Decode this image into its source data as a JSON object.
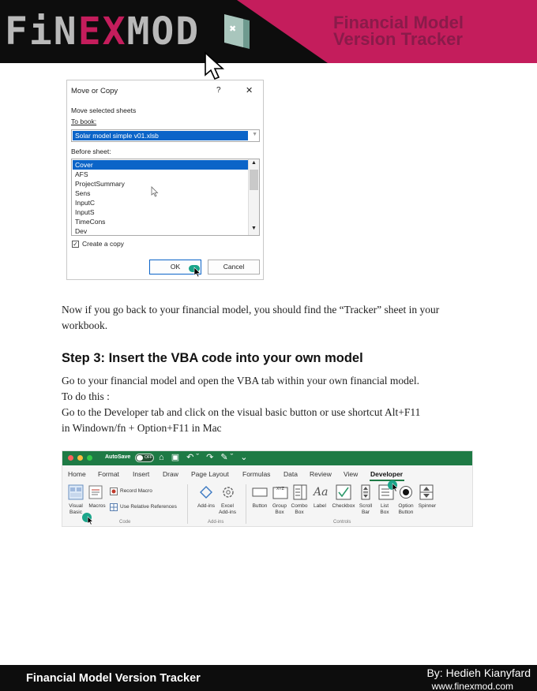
{
  "header": {
    "logo_part1": "FiN",
    "logo_part2": "EX",
    "logo_part3": "MOD",
    "title_line1": "Financial Model",
    "title_line2": "Version Tracker",
    "colors": {
      "banner_black": "#0d0d0d",
      "banner_pink": "#c41d5c",
      "logo_gray": "#b9b9b9"
    }
  },
  "dialog": {
    "title": "Move or Copy",
    "help": "?",
    "close": "✕",
    "move_selected_label": "Move selected sheets",
    "to_book_label": "To book:",
    "to_book_value": "Solar model simple v01.xlsb",
    "before_sheet_label": "Before sheet:",
    "sheets": [
      "Cover",
      "AFS",
      "ProjectSummary",
      "Sens",
      "InputC",
      "InputS",
      "TimeCons",
      "Dev"
    ],
    "selected_sheet": "Cover",
    "create_copy_label": "Create a copy",
    "create_copy_checked": true,
    "ok_label": "OK",
    "cancel_label": "Cancel"
  },
  "body": {
    "para1": "Now if you go back to your financial model, you should find the “Tracker” sheet in your workbook.",
    "step3_heading": "Step 3: Insert the VBA code into your own model",
    "para2_line1": "Go to your financial model and open the VBA tab within your own financial model.",
    "para2_line2": "To do this :",
    "para2_line3": "Go to the Developer tab and click on the visual basic button or use shortcut Alt+F11",
    "para2_line4": "in Windown/fn + Option+F11 in Mac"
  },
  "ribbon": {
    "autosave_label": "AutoSave",
    "autosave_state": "OFF",
    "tabs": [
      "Home",
      "Format",
      "Insert",
      "Draw",
      "Page Layout",
      "Formulas",
      "Data",
      "Review",
      "View",
      "Developer"
    ],
    "active_tab": "Developer",
    "code_group": {
      "visual_basic": "Visual Basic",
      "macros": "Macros",
      "record_macro": "Record Macro",
      "use_relative": "Use Relative References",
      "label": "Code"
    },
    "addins_group": {
      "addins": "Add-ins",
      "excel_addins": "Excel Add-ins",
      "label": "Add-ins"
    },
    "controls_group": {
      "button": "Button",
      "group_box": "Group Box",
      "combo_box": "Combo Box",
      "label_ctl": "Label",
      "checkbox": "Checkbox",
      "scroll_bar": "Scroll Bar",
      "list_box": "List Box",
      "option_button": "Option Button",
      "spinner": "Spinner",
      "label": "Controls",
      "label_icon_text": "Aa",
      "group_box_icon_text": "XYZ"
    },
    "colors": {
      "titlebar_green": "#1e7a45",
      "highlight_teal": "#1ba58a"
    }
  },
  "footer": {
    "title": "Financial Model Version Tracker",
    "author": "By: Hedieh Kianyfard",
    "url": "www.finexmod.com"
  }
}
